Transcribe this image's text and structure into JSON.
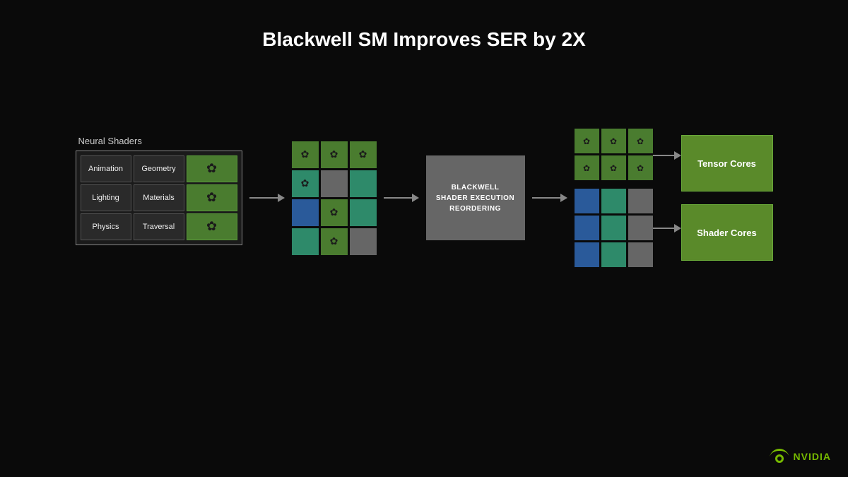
{
  "title": "Blackwell SM Improves SER by 2X",
  "neural_shaders_label": "Neural Shaders",
  "shader_cells": [
    {
      "label": "Animation",
      "type": "text"
    },
    {
      "label": "Geometry",
      "type": "text"
    },
    {
      "label": "",
      "type": "green-icon"
    },
    {
      "label": "Lighting",
      "type": "text"
    },
    {
      "label": "Materials",
      "type": "text"
    },
    {
      "label": "",
      "type": "green-icon"
    },
    {
      "label": "Physics",
      "type": "text"
    },
    {
      "label": "Traversal",
      "type": "text"
    },
    {
      "label": "",
      "type": "green-icon"
    }
  ],
  "ser_box": {
    "line1": "BLACKWELL",
    "line2": "SHADER EXECUTION",
    "line3": "REORDERING"
  },
  "tensor_cores_label": "Tensor Cores",
  "shader_cores_label": "Shader Cores",
  "nvidia_label": "NVIDIA"
}
